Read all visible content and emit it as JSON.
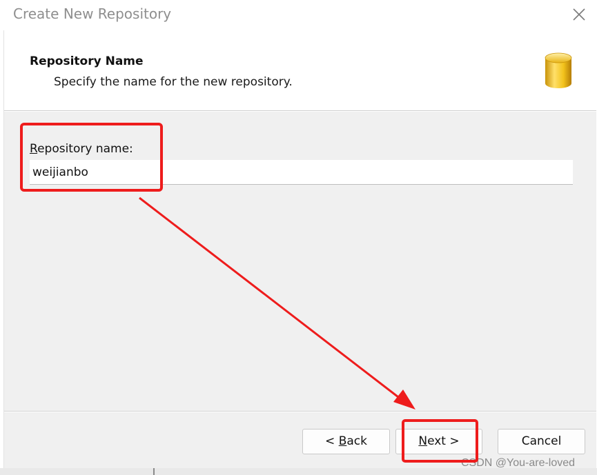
{
  "window": {
    "title": "Create New Repository"
  },
  "header": {
    "title": "Repository Name",
    "subtitle": "Specify the name for the new repository.",
    "icon": "database-icon"
  },
  "form": {
    "repo_name_label_mnemonic": "R",
    "repo_name_label_rest": "epository name:",
    "repo_name_value": "weijianbo"
  },
  "buttons": {
    "back_prefix": "< ",
    "back_mnemonic": "B",
    "back_rest": "ack",
    "next_mnemonic": "N",
    "next_rest": "ext >",
    "cancel": "Cancel"
  },
  "watermark": "CSDN @You-are-loved",
  "colors": {
    "annotation_red": "#ee1c1c",
    "dialog_body": "#f0f0f0",
    "title_text": "#8e8e8e",
    "database_gold": "#f2c21b"
  }
}
